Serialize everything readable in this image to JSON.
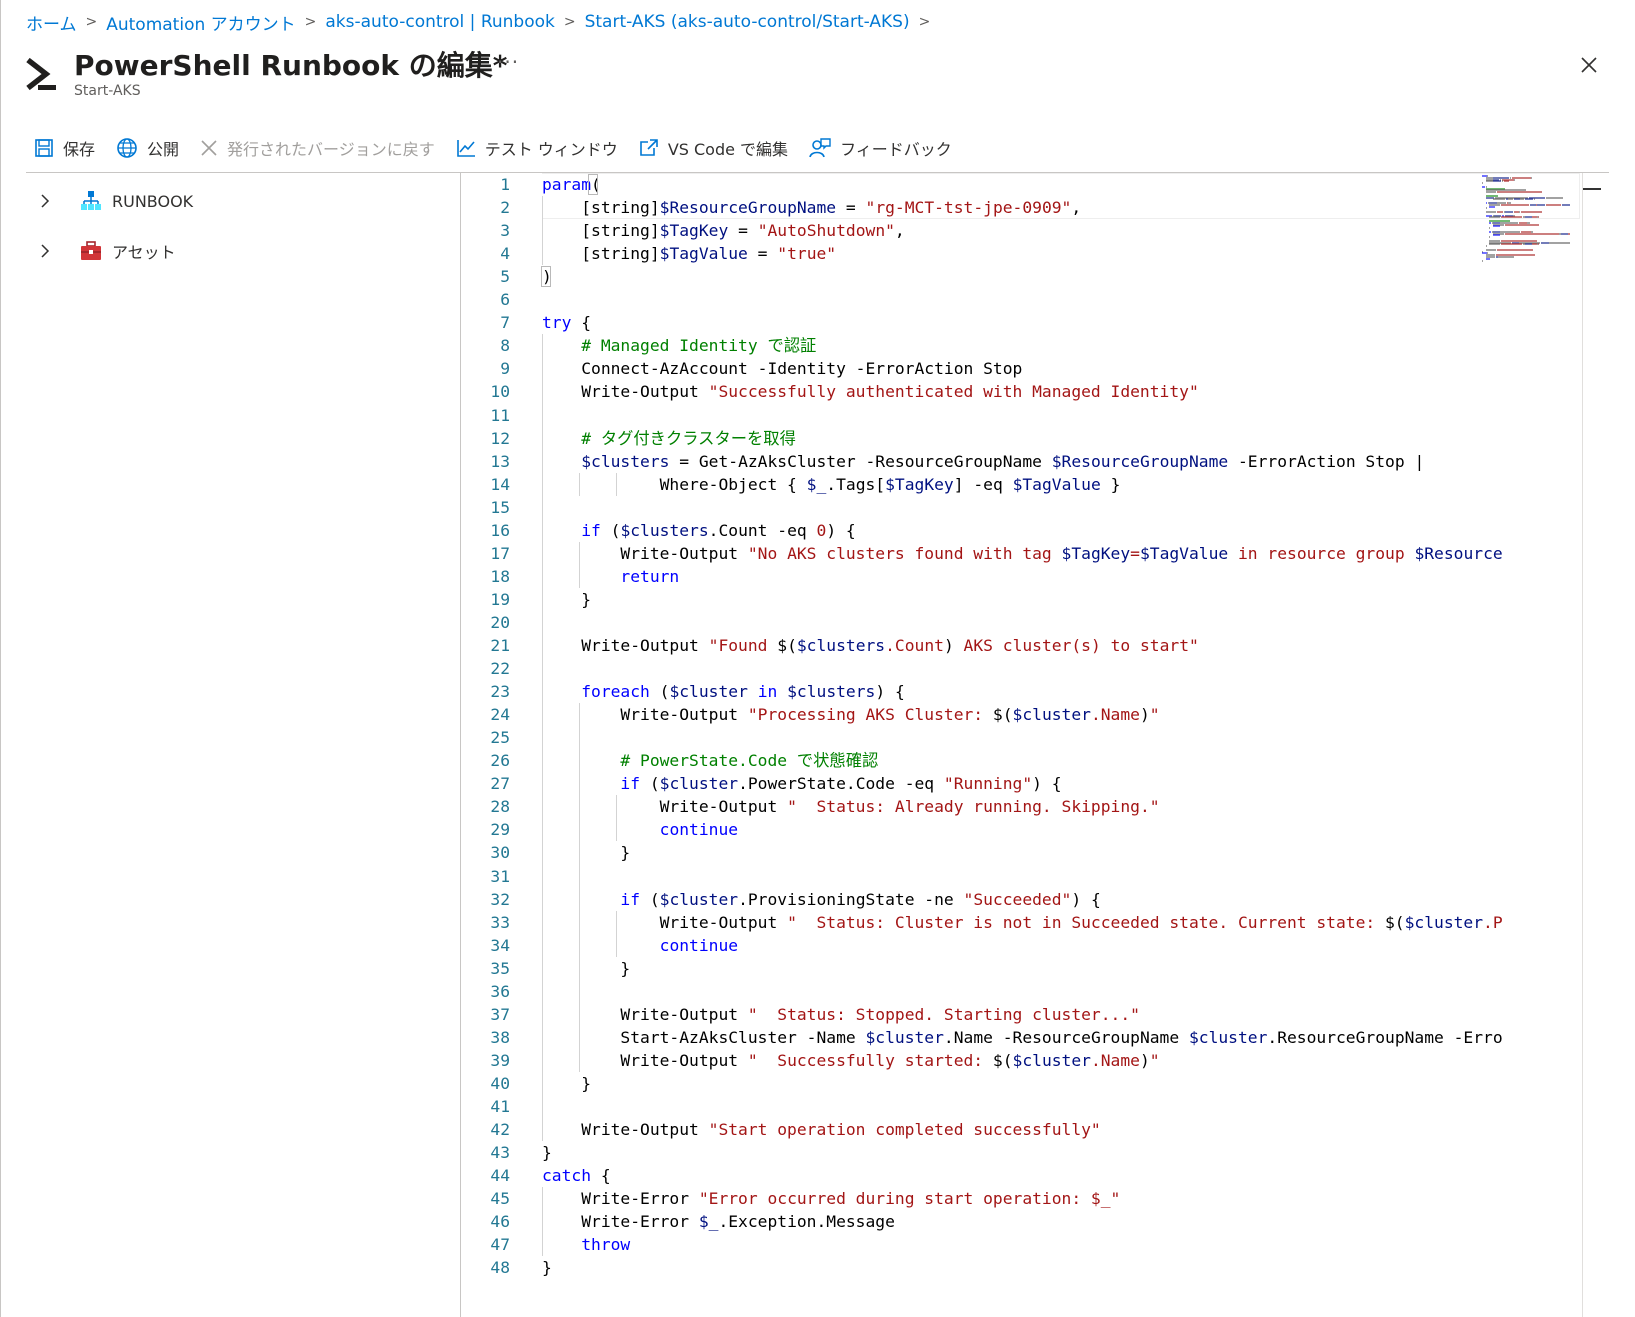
{
  "breadcrumb": [
    {
      "label": "ホーム"
    },
    {
      "label": "Automation アカウント"
    },
    {
      "label": "aks-auto-control | Runbook"
    },
    {
      "label": "Start-AKS (aks-auto-control/Start-AKS)"
    }
  ],
  "header": {
    "title": "PowerShell Runbook の編集*",
    "subtitle": "Start-AKS",
    "more_label": "···"
  },
  "toolbar": {
    "save": "保存",
    "publish": "公開",
    "revert": "発行されたバージョンに戻す",
    "test_window": "テスト ウィンドウ",
    "vscode": "VS Code で編集",
    "feedback": "フィードバック"
  },
  "tree": {
    "runbook": "RUNBOOK",
    "assets": "アセット"
  },
  "editor": {
    "language": "powershell",
    "lines": [
      [
        [
          "kw",
          "param"
        ],
        [
          "pl",
          "("
        ]
      ],
      [
        [
          "pl",
          "    [string]"
        ],
        [
          "var",
          "$ResourceGroupName"
        ],
        [
          "pl",
          " = "
        ],
        [
          "str",
          "\"rg-MCT-tst-jpe-0909\""
        ],
        [
          "pl",
          ","
        ]
      ],
      [
        [
          "pl",
          "    [string]"
        ],
        [
          "var",
          "$TagKey"
        ],
        [
          "pl",
          " = "
        ],
        [
          "str",
          "\"AutoShutdown\""
        ],
        [
          "pl",
          ","
        ]
      ],
      [
        [
          "pl",
          "    [string]"
        ],
        [
          "var",
          "$TagValue"
        ],
        [
          "pl",
          " = "
        ],
        [
          "str",
          "\"true\""
        ]
      ],
      [
        [
          "pl",
          ")"
        ]
      ],
      [],
      [
        [
          "kw",
          "try"
        ],
        [
          "pl",
          " {"
        ]
      ],
      [
        [
          "pl",
          "    "
        ],
        [
          "cmt",
          "# Managed Identity で認証"
        ]
      ],
      [
        [
          "pl",
          "    Connect-AzAccount -Identity -ErrorAction Stop"
        ]
      ],
      [
        [
          "pl",
          "    Write-Output "
        ],
        [
          "str",
          "\"Successfully authenticated with Managed Identity\""
        ]
      ],
      [],
      [
        [
          "pl",
          "    "
        ],
        [
          "cmt",
          "# タグ付きクラスターを取得"
        ]
      ],
      [
        [
          "pl",
          "    "
        ],
        [
          "var",
          "$clusters"
        ],
        [
          "pl",
          " = Get-AzAksCluster -ResourceGroupName "
        ],
        [
          "var",
          "$ResourceGroupName"
        ],
        [
          "pl",
          " -ErrorAction Stop |"
        ]
      ],
      [
        [
          "pl",
          "            Where-Object { "
        ],
        [
          "var",
          "$_"
        ],
        [
          "pl",
          ".Tags["
        ],
        [
          "var",
          "$TagKey"
        ],
        [
          "pl",
          "] -eq "
        ],
        [
          "var",
          "$TagValue"
        ],
        [
          "pl",
          " }"
        ]
      ],
      [],
      [
        [
          "pl",
          "    "
        ],
        [
          "kw",
          "if"
        ],
        [
          "pl",
          " ("
        ],
        [
          "var",
          "$clusters"
        ],
        [
          "pl",
          ".Count -eq "
        ],
        [
          "str",
          "0"
        ],
        [
          "pl",
          ") {"
        ]
      ],
      [
        [
          "pl",
          "        Write-Output "
        ],
        [
          "str",
          "\"No AKS clusters found with tag "
        ],
        [
          "var",
          "$TagKey"
        ],
        [
          "str",
          "="
        ],
        [
          "var",
          "$TagValue"
        ],
        [
          "str",
          " in resource group "
        ],
        [
          "var",
          "$Resource"
        ]
      ],
      [
        [
          "pl",
          "        "
        ],
        [
          "kw",
          "return"
        ]
      ],
      [
        [
          "pl",
          "    }"
        ]
      ],
      [],
      [
        [
          "pl",
          "    Write-Output "
        ],
        [
          "str",
          "\"Found "
        ],
        [
          "pl",
          "$("
        ],
        [
          "var",
          "$clusters"
        ],
        [
          "str",
          ".Count"
        ],
        [
          "pl",
          ")"
        ],
        [
          "str",
          " AKS cluster(s) to start\""
        ]
      ],
      [],
      [
        [
          "pl",
          "    "
        ],
        [
          "kw",
          "foreach"
        ],
        [
          "pl",
          " ("
        ],
        [
          "var",
          "$cluster"
        ],
        [
          "pl",
          " "
        ],
        [
          "kw",
          "in"
        ],
        [
          "pl",
          " "
        ],
        [
          "var",
          "$clusters"
        ],
        [
          "pl",
          ") {"
        ]
      ],
      [
        [
          "pl",
          "        Write-Output "
        ],
        [
          "str",
          "\"Processing AKS Cluster: "
        ],
        [
          "pl",
          "$("
        ],
        [
          "var",
          "$cluster"
        ],
        [
          "str",
          ".Name"
        ],
        [
          "pl",
          ")"
        ],
        [
          "str",
          "\""
        ]
      ],
      [],
      [
        [
          "pl",
          "        "
        ],
        [
          "cmt",
          "# PowerState.Code で状態確認"
        ]
      ],
      [
        [
          "pl",
          "        "
        ],
        [
          "kw",
          "if"
        ],
        [
          "pl",
          " ("
        ],
        [
          "var",
          "$cluster"
        ],
        [
          "pl",
          ".PowerState.Code -eq "
        ],
        [
          "str",
          "\"Running\""
        ],
        [
          "pl",
          ") {"
        ]
      ],
      [
        [
          "pl",
          "            Write-Output "
        ],
        [
          "str",
          "\"  Status: Already running. Skipping.\""
        ]
      ],
      [
        [
          "pl",
          "            "
        ],
        [
          "kw",
          "continue"
        ]
      ],
      [
        [
          "pl",
          "        }"
        ]
      ],
      [],
      [
        [
          "pl",
          "        "
        ],
        [
          "kw",
          "if"
        ],
        [
          "pl",
          " ("
        ],
        [
          "var",
          "$cluster"
        ],
        [
          "pl",
          ".ProvisioningState -ne "
        ],
        [
          "str",
          "\"Succeeded\""
        ],
        [
          "pl",
          ") {"
        ]
      ],
      [
        [
          "pl",
          "            Write-Output "
        ],
        [
          "str",
          "\"  Status: Cluster is not in Succeeded state. Current state: "
        ],
        [
          "pl",
          "$("
        ],
        [
          "var",
          "$cluster"
        ],
        [
          "str",
          ".P"
        ]
      ],
      [
        [
          "pl",
          "            "
        ],
        [
          "kw",
          "continue"
        ]
      ],
      [
        [
          "pl",
          "        }"
        ]
      ],
      [],
      [
        [
          "pl",
          "        Write-Output "
        ],
        [
          "str",
          "\"  Status: Stopped. Starting cluster...\""
        ]
      ],
      [
        [
          "pl",
          "        Start-AzAksCluster -Name "
        ],
        [
          "var",
          "$cluster"
        ],
        [
          "pl",
          ".Name -ResourceGroupName "
        ],
        [
          "var",
          "$cluster"
        ],
        [
          "pl",
          ".ResourceGroupName -Erro"
        ]
      ],
      [
        [
          "pl",
          "        Write-Output "
        ],
        [
          "str",
          "\"  Successfully started: "
        ],
        [
          "pl",
          "$("
        ],
        [
          "var",
          "$cluster"
        ],
        [
          "str",
          ".Name"
        ],
        [
          "pl",
          ")"
        ],
        [
          "str",
          "\""
        ]
      ],
      [
        [
          "pl",
          "    }"
        ]
      ],
      [],
      [
        [
          "pl",
          "    Write-Output "
        ],
        [
          "str",
          "\"Start operation completed successfully\""
        ]
      ],
      [
        [
          "pl",
          "}"
        ]
      ],
      [
        [
          "kw",
          "catch"
        ],
        [
          "pl",
          " {"
        ]
      ],
      [
        [
          "pl",
          "    Write-Error "
        ],
        [
          "str",
          "\"Error occurred during start operation: $_\""
        ]
      ],
      [
        [
          "pl",
          "    Write-Error "
        ],
        [
          "var",
          "$_"
        ],
        [
          "pl",
          ".Exception.Message"
        ]
      ],
      [
        [
          "pl",
          "    "
        ],
        [
          "kw",
          "throw"
        ]
      ],
      [
        [
          "pl",
          "}"
        ]
      ]
    ]
  },
  "colors": {
    "accent": "#0078d4",
    "keyword": "#0000ff",
    "variable": "#001080",
    "string": "#a31515",
    "comment": "#008000",
    "line_number": "#237893"
  },
  "icons": {
    "header": "powershell-icon",
    "save": "save-icon",
    "publish": "globe-icon",
    "revert": "close-x-icon",
    "test": "chart-line-icon",
    "vscode": "external-link-icon",
    "feedback": "feedback-person-icon",
    "close": "close-icon"
  }
}
